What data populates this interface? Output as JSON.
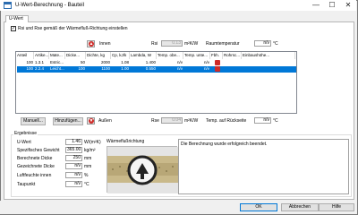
{
  "window": {
    "title": "U-Wert-Berechnung - Bauteil",
    "min": "—",
    "max": "☐",
    "close": "✕"
  },
  "tab": {
    "label": "U-Wert"
  },
  "options": {
    "flow_direction_checkbox": "Rsi und Rse gemäß der Wärmefluß-Richtung einstellen",
    "checked": true
  },
  "inside": {
    "label": "Innen",
    "rsi_label": "Rsi",
    "rsi_value": "0.13",
    "rsi_unit": "m²K/W",
    "temp_label": "Raumtemperatur",
    "temp_value": "n/v",
    "temp_unit": "°C"
  },
  "table": {
    "headers": [
      "Anteil",
      "Artike...",
      "Mate...",
      "Dicke...",
      "Dichte, kg",
      "Cp, kJ/k",
      "Lambda, W",
      "Temp. obe...",
      "Temp. unte...",
      "Fbh.",
      "Rohrsc...",
      "Einbaushöhe..."
    ],
    "rows": [
      [
        "100",
        "1.3.1",
        "Estric...",
        "50",
        "2000",
        "1.08",
        "1.400",
        "n/v",
        "n/v",
        "",
        "",
        ""
      ],
      [
        "100",
        "2.2.4",
        "Leicht...",
        "100",
        "1100",
        "1.00",
        "0.550",
        "n/v",
        "n/v",
        "",
        "",
        ""
      ]
    ],
    "selected_row": 1
  },
  "actions": {
    "manual": "Manuell...",
    "add": "Hinzufügen...",
    "outside_label": "Außen"
  },
  "outside": {
    "rse_label": "Rse",
    "rse_value": "0.04",
    "rse_unit": "m²K/W",
    "temp_label": "Temp. auf Rückseite",
    "temp_value": "n/v",
    "temp_unit": "°C"
  },
  "results": {
    "group_title": "Ergebnisse",
    "u_label": "U-Wert",
    "u_value": "1.46",
    "u_unit": "W/(m²K)",
    "weight_label": "Spezifisches Gewicht",
    "weight_value": "365.00",
    "weight_unit": "kg/m²",
    "thickness_label": "Berechnete Dicke",
    "thickness_value": "250",
    "thickness_unit": "mm",
    "drawn_label": "Gezeichnete Dicke",
    "drawn_value": "n/v",
    "drawn_unit": "mm",
    "humidity_label": "Luftfeuchte innen",
    "humidity_value": "n/v",
    "humidity_unit": "%",
    "dew_label": "Taupunkt",
    "dew_value": "n/v",
    "dew_unit": "°C",
    "flow_title": "Wärmeflußrichtung",
    "message": "Die Berechnung wurde erfolgreich beendet."
  },
  "footer": {
    "ok": "OK",
    "cancel": "Abbrechen",
    "help": "Hilfe"
  },
  "colors": {
    "accent": "#0078d7",
    "red_button": "#cf2a27",
    "window_bg": "#f0f0f0"
  }
}
